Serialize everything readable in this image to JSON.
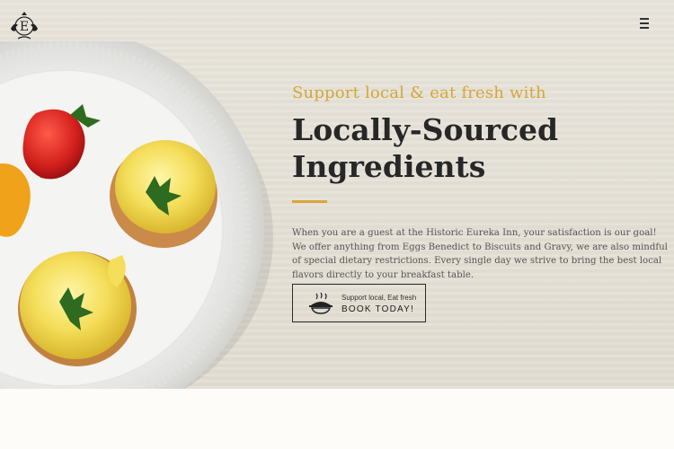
{
  "header": {
    "logo_icon": "ornate-e-crest-icon",
    "menu_icon": "hamburger-menu-icon"
  },
  "hero": {
    "eyebrow": "Support local & eat fresh with",
    "headline_line1": "Locally-Sourced",
    "headline_line2": "Ingredients",
    "body": "When you are a guest at the Historic Eureka Inn, your satisfaction is our goal! We offer anything from Eggs Benedict to Biscuits and Gravy, we are also mindful of special dietary restrictions. Every single day we strive to bring the best local flavors directly to your breakfast table.",
    "accent_color": "#d9a63a",
    "cta": {
      "icon": "serving-dish-icon",
      "small_label": "Support local, Eat fresh",
      "label": "BOOK TODAY!"
    }
  }
}
